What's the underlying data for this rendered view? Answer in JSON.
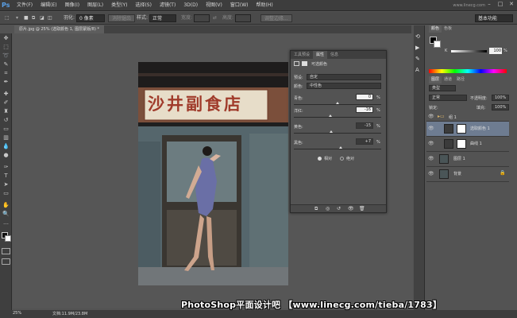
{
  "app": {
    "logo": "Ps",
    "workspace": "基本功能",
    "watermark_top": "www.linecg.com"
  },
  "menu": [
    "文件(F)",
    "编辑(E)",
    "图像(I)",
    "图层(L)",
    "类型(Y)",
    "选择(S)",
    "滤镜(T)",
    "3D(D)",
    "视图(V)",
    "窗口(W)",
    "帮助(H)"
  ],
  "options": {
    "feather_label": "羽化:",
    "feather_value": "0 像素",
    "antialias": "消除锯齿",
    "style_label": "样式:",
    "style_value": "正常",
    "width_label": "宽度:",
    "height_label": "高度:",
    "refine": "调整边缘..."
  },
  "document": {
    "tab": "原片.jpg @ 25% (选取颜色 1, 图层蒙版/8) *",
    "zoom": "25%",
    "doc_size": "文档:11.9M/23.8M"
  },
  "properties": {
    "tabs": [
      "工具预设",
      "属性",
      "信息"
    ],
    "title": "可选颜色",
    "preset_label": "预设:",
    "preset_value": "自定",
    "color_label": "颜色:",
    "color_value": "中性色",
    "sliders": [
      {
        "label": "青色:",
        "value": "0",
        "unit": "%"
      },
      {
        "label": "洋红:",
        "value": "-16",
        "unit": "%"
      },
      {
        "label": "黄色:",
        "value": "-15",
        "unit": "%"
      },
      {
        "label": "黑色:",
        "value": "+7",
        "unit": "%"
      }
    ],
    "radio_relative": "相对",
    "radio_absolute": "绝对"
  },
  "color_panel": {
    "tabs": [
      "颜色",
      "色板"
    ],
    "k_label": "K",
    "k_value": "100",
    "k_unit": "%"
  },
  "layers_panel": {
    "tabs": [
      "图层",
      "通道",
      "路径"
    ],
    "kind": "类型",
    "blend": "正常",
    "opacity_label": "不透明度:",
    "opacity": "100%",
    "lock_label": "锁定:",
    "fill_label": "填充:",
    "fill": "100%",
    "layers": [
      {
        "name": "组 1",
        "type": "group"
      },
      {
        "name": "选取颜色 1",
        "type": "adjust",
        "selected": true
      },
      {
        "name": "曲线 1",
        "type": "adjust"
      },
      {
        "name": "图层 1",
        "type": "pixel"
      },
      {
        "name": "背景",
        "type": "pixel"
      }
    ]
  },
  "photo": {
    "sign": "沙井副食店"
  },
  "footer_watermark": "PhotoShop平面设计吧 【www.linecg.com/tieba/1783】"
}
